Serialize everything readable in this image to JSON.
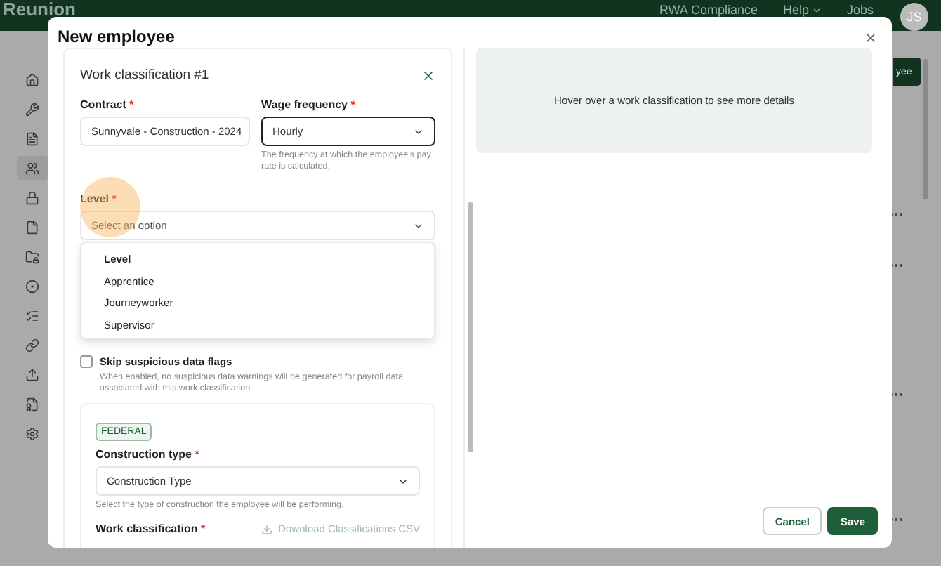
{
  "app": {
    "logo": "Reunion",
    "nav": [
      {
        "label": "RWA Compliance",
        "dropdown": false
      },
      {
        "label": "Help",
        "dropdown": true
      },
      {
        "label": "Jobs",
        "dropdown": false
      }
    ],
    "avatar": "JS",
    "primary_button": "yee"
  },
  "sidebar": {
    "items": [
      {
        "selected": false
      },
      {
        "selected": false
      },
      {
        "selected": false
      },
      {
        "selected": true
      },
      {
        "selected": false
      },
      {
        "selected": false
      },
      {
        "selected": false
      },
      {
        "selected": false
      },
      {
        "selected": false
      },
      {
        "selected": false
      },
      {
        "selected": false
      },
      {
        "selected": false
      },
      {
        "selected": false
      }
    ]
  },
  "modal": {
    "title": "New employee",
    "classification": {
      "title": "Work classification #1",
      "contract": {
        "label": "Contract",
        "required_mark": "*",
        "value": "Sunnyvale - Construction - 2024",
        "focused": false
      },
      "wage_frequency": {
        "label": "Wage frequency",
        "required_mark": "*",
        "value": "Hourly",
        "focused": true,
        "help": "The frequency at which the employee's pay rate is calculated."
      },
      "level": {
        "label": "Level",
        "required_mark": "*",
        "placeholder": "Select an option",
        "expanded": true,
        "options": [
          {
            "label": "Level",
            "kind": "header"
          },
          {
            "label": "Apprentice",
            "kind": "option"
          },
          {
            "label": "Journeyworker",
            "kind": "option"
          },
          {
            "label": "Supervisor",
            "kind": "option"
          }
        ]
      },
      "skip_flags": {
        "label": "Skip suspicious data flags",
        "checked": false,
        "help": "When enabled, no suspicious data warnings will be generated for payroll data associated with this work classification."
      },
      "federal": {
        "badge": "FEDERAL",
        "construction_type": {
          "label": "Construction type",
          "required_mark": "*",
          "value": "Construction Type",
          "help": "Select the type of construction the employee will be performing."
        },
        "work_classification": {
          "label": "Work classification",
          "required_mark": "*",
          "download": "Download Classifications CSV",
          "download_disabled": true
        }
      }
    },
    "details": "Hover over a work classification to see more details",
    "buttons": [
      {
        "label": "Cancel",
        "kind": "secondary"
      },
      {
        "label": "Save",
        "kind": "primary"
      }
    ]
  }
}
